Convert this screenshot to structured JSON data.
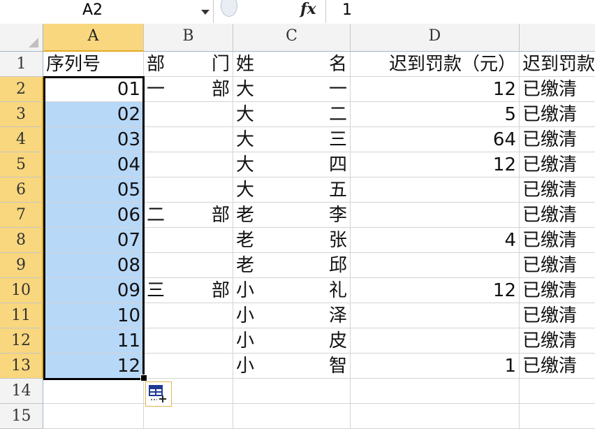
{
  "formula_bar": {
    "name_box": "A2",
    "fx_label": "fx",
    "value": "1"
  },
  "columns": [
    "A",
    "B",
    "C",
    "D",
    ""
  ],
  "row_numbers": [
    "1",
    "2",
    "3",
    "4",
    "5",
    "6",
    "7",
    "8",
    "9",
    "10",
    "11",
    "12",
    "13",
    "14",
    "15"
  ],
  "header_row": {
    "a": "序列号",
    "b": [
      "部",
      "门"
    ],
    "c": [
      "姓",
      "名"
    ],
    "d": "迟到罚款（元）",
    "e": "迟到罚款"
  },
  "rows": [
    {
      "a": "01",
      "b": [
        "一",
        "部"
      ],
      "c": [
        "大",
        "一"
      ],
      "d": "12",
      "e": "已缴清"
    },
    {
      "a": "02",
      "b": [
        "",
        ""
      ],
      "c": [
        "大",
        "二"
      ],
      "d": "5",
      "e": "已缴清"
    },
    {
      "a": "03",
      "b": [
        "",
        ""
      ],
      "c": [
        "大",
        "三"
      ],
      "d": "64",
      "e": "已缴清"
    },
    {
      "a": "04",
      "b": [
        "",
        ""
      ],
      "c": [
        "大",
        "四"
      ],
      "d": "12",
      "e": "已缴清"
    },
    {
      "a": "05",
      "b": [
        "",
        ""
      ],
      "c": [
        "大",
        "五"
      ],
      "d": "",
      "e": "已缴清"
    },
    {
      "a": "06",
      "b": [
        "二",
        "部"
      ],
      "c": [
        "老",
        "李"
      ],
      "d": "",
      "e": "已缴清"
    },
    {
      "a": "07",
      "b": [
        "",
        ""
      ],
      "c": [
        "老",
        "张"
      ],
      "d": "4",
      "e": "已缴清"
    },
    {
      "a": "08",
      "b": [
        "",
        ""
      ],
      "c": [
        "老",
        "邱"
      ],
      "d": "",
      "e": "已缴清"
    },
    {
      "a": "09",
      "b": [
        "三",
        "部"
      ],
      "c": [
        "小",
        "礼"
      ],
      "d": "12",
      "e": "已缴清"
    },
    {
      "a": "10",
      "b": [
        "",
        ""
      ],
      "c": [
        "小",
        "泽"
      ],
      "d": "",
      "e": "已缴清"
    },
    {
      "a": "11",
      "b": [
        "",
        ""
      ],
      "c": [
        "小",
        "皮"
      ],
      "d": "",
      "e": "已缴清"
    },
    {
      "a": "12",
      "b": [
        "",
        ""
      ],
      "c": [
        "小",
        "智"
      ],
      "d": "1",
      "e": "已缴清"
    }
  ],
  "colors": {
    "selection_fill": "#b8d8f8",
    "selected_header": "#f9d77e",
    "header_bg": "#f3f3f3"
  }
}
